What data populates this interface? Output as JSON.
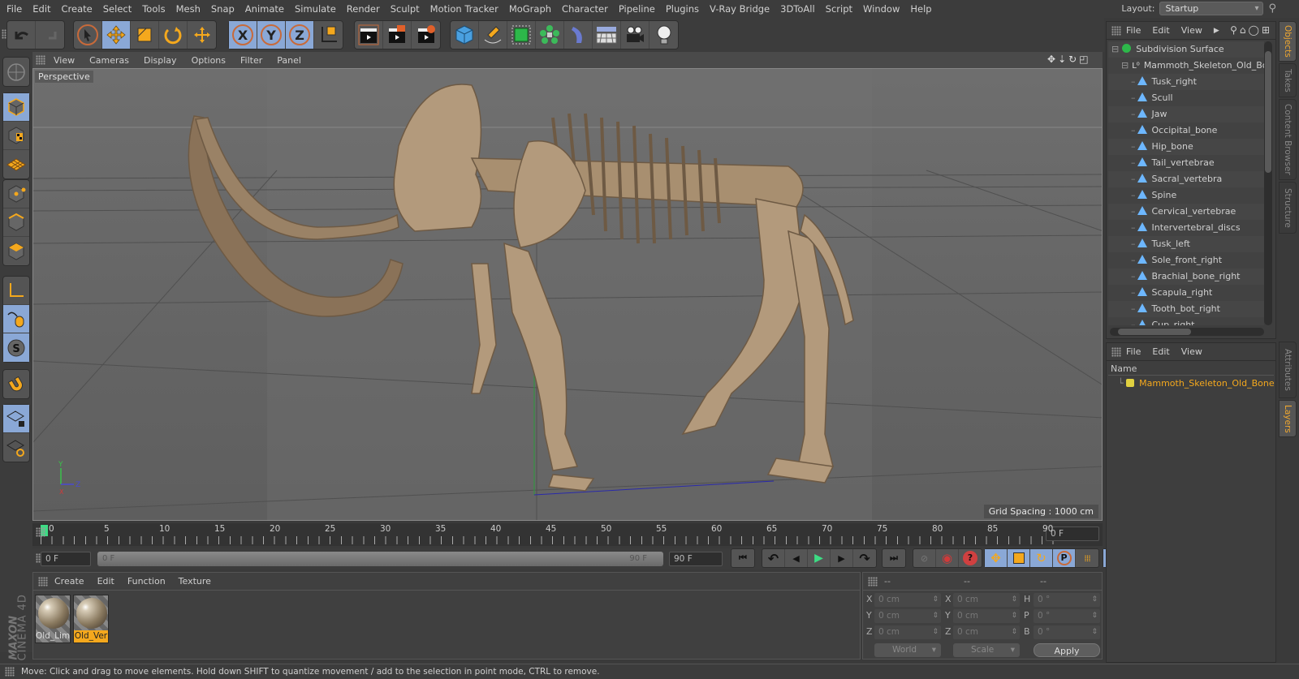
{
  "menu": [
    "File",
    "Edit",
    "Create",
    "Select",
    "Tools",
    "Mesh",
    "Snap",
    "Animate",
    "Simulate",
    "Render",
    "Sculpt",
    "Motion Tracker",
    "MoGraph",
    "Character",
    "Pipeline",
    "Plugins",
    "V-Ray Bridge",
    "3DToAll",
    "Script",
    "Window",
    "Help"
  ],
  "layout": {
    "label": "Layout:",
    "value": "Startup"
  },
  "toolbar": {
    "undo": "undo-icon",
    "redo": "redo-icon",
    "tools": [
      "live-selection",
      "move",
      "scale",
      "rotate",
      "recent-tool"
    ],
    "axes": [
      "X",
      "Y",
      "Z"
    ],
    "coord_system": "world-coordinate-icon",
    "render": [
      "render-view",
      "render-to-picture-viewer",
      "render-settings"
    ],
    "create": [
      "cube",
      "pen",
      "subdivision",
      "cloner",
      "deformer",
      "floor",
      "camera",
      "light"
    ]
  },
  "viewport": {
    "menu": [
      "View",
      "Cameras",
      "Display",
      "Options",
      "Filter",
      "Panel"
    ],
    "camera_label": "Perspective",
    "grid_spacing": "Grid Spacing : 1000 cm",
    "axis_labels": {
      "y": "Y",
      "z": "Z",
      "x": "X"
    }
  },
  "timeline": {
    "ticks": [
      "0",
      "5",
      "10",
      "15",
      "20",
      "25",
      "30",
      "35",
      "40",
      "45",
      "50",
      "55",
      "60",
      "65",
      "70",
      "75",
      "80",
      "85",
      "90"
    ],
    "current_frame": "0 F",
    "start_field": "0 F",
    "range_start": "0 F",
    "range_end": "90 F",
    "end_field": "90 F"
  },
  "materials": {
    "menu": [
      "Create",
      "Edit",
      "Function",
      "Texture"
    ],
    "items": [
      {
        "name": "Old_Lim",
        "selected": false
      },
      {
        "name": "Old_Ver",
        "selected": true
      }
    ]
  },
  "coordinates": {
    "headers": [
      "--",
      "--",
      "--"
    ],
    "position": [
      {
        "axis": "X",
        "value": "0 cm"
      },
      {
        "axis": "Y",
        "value": "0 cm"
      },
      {
        "axis": "Z",
        "value": "0 cm"
      }
    ],
    "size": [
      {
        "axis": "X",
        "value": "0 cm"
      },
      {
        "axis": "Y",
        "value": "0 cm"
      },
      {
        "axis": "Z",
        "value": "0 cm"
      }
    ],
    "rotation": [
      {
        "axis": "H",
        "value": "0 °"
      },
      {
        "axis": "P",
        "value": "0 °"
      },
      {
        "axis": "B",
        "value": "0 °"
      }
    ],
    "mode1": "World",
    "mode2": "Scale",
    "apply": "Apply"
  },
  "objects": {
    "menu": [
      "File",
      "Edit",
      "View"
    ],
    "root": "Subdivision Surface",
    "group": "Mammoth_Skeleton_Old_Bones",
    "children": [
      "Tusk_right",
      "Scull",
      "Jaw",
      "Occipital_bone",
      "Hip_bone",
      "Tail_vertebrae",
      "Sacral_vertebra",
      "Spine",
      "Cervical_vertebrae",
      "Intervertebral_discs",
      "Tusk_left",
      "Sole_front_right",
      "Brachial_bone_right",
      "Scapula_right",
      "Tooth_bot_right",
      "Cup_right"
    ]
  },
  "side_tabs_top": [
    "Objects",
    "Takes",
    "Content Browser",
    "Structure"
  ],
  "side_tabs_bottom": [
    "Attributes",
    "Layers"
  ],
  "layers": {
    "menu": [
      "File",
      "Edit",
      "View"
    ],
    "column": "Name",
    "items": [
      {
        "name": "Mammoth_Skeleton_Old_Bones_V",
        "color": "#e0d040"
      }
    ]
  },
  "status": "Move: Click and drag to move elements. Hold down SHIFT to quantize movement / add to the selection in point mode, CTRL to remove.",
  "brand": {
    "line1": "MAXON",
    "line2": "CINEMA 4D"
  },
  "colors": {
    "accent": "#f4a81d",
    "selected_bg": "#8aa8d6",
    "play": "#3ddc84"
  }
}
